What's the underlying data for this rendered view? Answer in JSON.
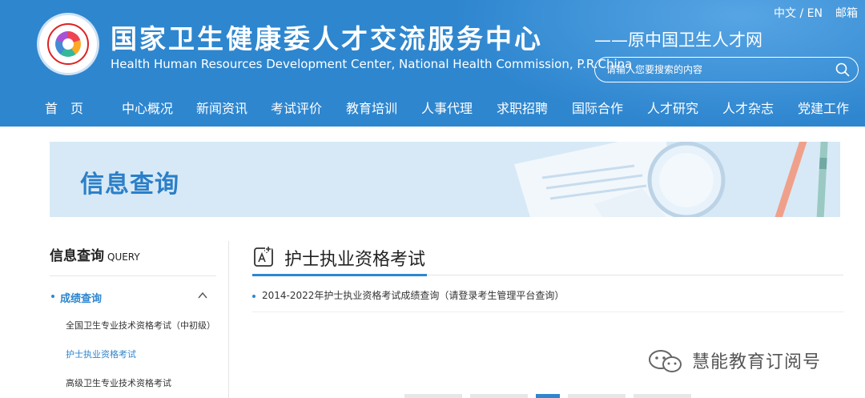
{
  "header": {
    "title_cn": "国家卫生健康委人才交流服务中心",
    "title_en": "Health Human Resources Development Center, National Health Commission, P.R.China",
    "subtitle": "——原中国卫生人才网",
    "lang_switch": "中文 / EN",
    "mail_label": "邮箱",
    "search_placeholder": "请输入您要搜索的内容",
    "background_color": "#2e86cf"
  },
  "nav": {
    "items": [
      {
        "label": "首　页"
      },
      {
        "label": "中心概况"
      },
      {
        "label": "新闻资讯"
      },
      {
        "label": "考试评价"
      },
      {
        "label": "教育培训"
      },
      {
        "label": "人事代理"
      },
      {
        "label": "求职招聘"
      },
      {
        "label": "国际合作"
      },
      {
        "label": "人才研究"
      },
      {
        "label": "人才杂志"
      },
      {
        "label": "党建工作"
      }
    ]
  },
  "banner": {
    "title": "信息查询"
  },
  "sidebar": {
    "title": "信息查询",
    "title_en": "QUERY",
    "section_label": "成绩查询",
    "items": [
      {
        "label": "全国卫生专业技术资格考试（中初级）"
      },
      {
        "label": "护士执业资格考试"
      },
      {
        "label": "高级卫生专业技术资格考试"
      }
    ],
    "accent_color": "#2e86cf"
  },
  "main": {
    "title": "护士执业资格考试",
    "list": [
      {
        "label": "2014-2022年护士执业资格考试成绩查询（请登录考生管理平台查询）"
      }
    ]
  },
  "watermark": {
    "text": "慧能教育订阅号",
    "icon": "wechat-icon"
  }
}
